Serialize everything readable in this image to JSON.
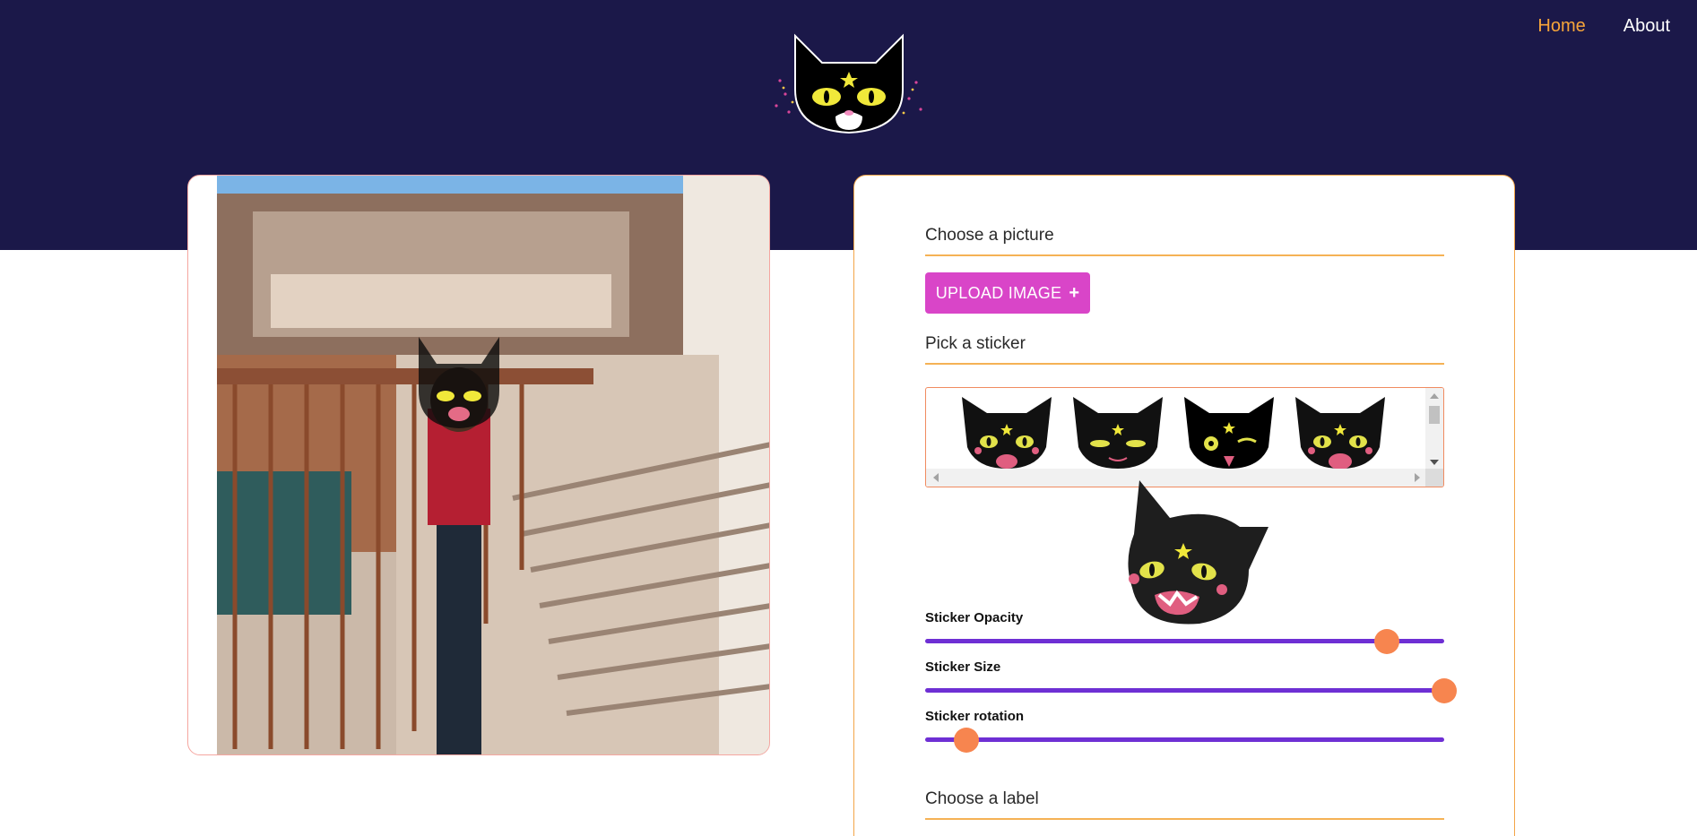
{
  "nav": {
    "home": "Home",
    "about": "About"
  },
  "header": {
    "logo_icon": "cat-face-logo-icon"
  },
  "editor": {
    "choose_picture": "Choose a picture",
    "upload_label": "UPLOAD IMAGE",
    "upload_icon": "+",
    "pick_sticker": "Pick a sticker",
    "stickers": [
      {
        "name": "cat-sticker-smile-icon"
      },
      {
        "name": "cat-sticker-sly-icon"
      },
      {
        "name": "cat-sticker-tongue-icon"
      },
      {
        "name": "cat-sticker-laugh-icon"
      }
    ],
    "selected_sticker_icon": "cat-sticker-selected-preview-icon",
    "sliders": {
      "opacity": {
        "label": "Sticker Opacity",
        "value": 0.89
      },
      "size": {
        "label": "Sticker Size",
        "value": 1.0
      },
      "rotation": {
        "label": "Sticker rotation",
        "value": 0.08
      }
    },
    "choose_label": "Choose a label"
  },
  "colors": {
    "header_bg": "#1b1849",
    "nav_active": "#f7a53a",
    "upload_button": "#d945c8",
    "slider_track": "#6e2fd4",
    "slider_knob": "#f7854f",
    "section_underline": "#f5b255"
  }
}
